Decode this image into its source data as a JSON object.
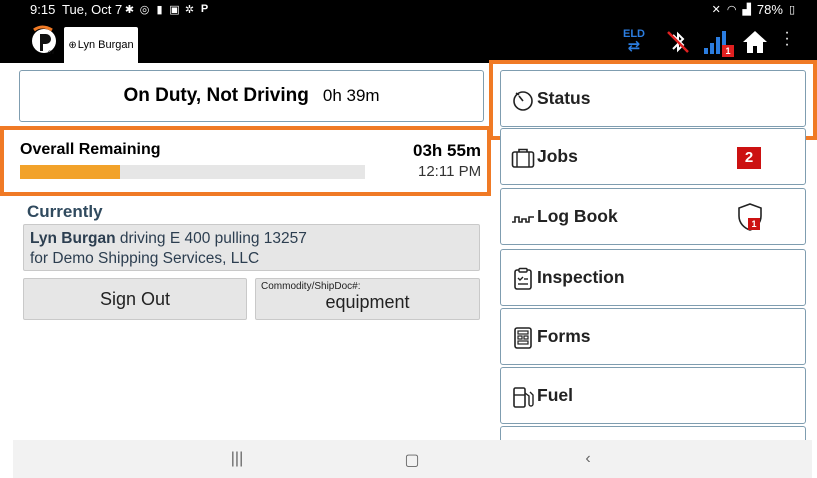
{
  "status_bar": {
    "time": "9:15",
    "date": "Tue, Oct 7",
    "left_icons": [
      "bluetooth-icon",
      "sync-icon",
      "battery-saver-icon",
      "gallery-icon",
      "settings-icon",
      "p-app-icon"
    ],
    "battery": "78%",
    "right_icons": [
      "mute-icon",
      "wifi-icon",
      "cellular-icon",
      "battery-icon"
    ]
  },
  "app_bar": {
    "user_tab": "Lyn Burgan",
    "eld_label": "ELD",
    "signal_badge": "1"
  },
  "duty": {
    "status": "On Duty, Not Driving",
    "elapsed": "0h 39m"
  },
  "remaining": {
    "title": "Overall Remaining",
    "time": "03h 55m",
    "clock": "12:11 PM",
    "progress_fraction": 0.29
  },
  "currently": {
    "heading": "Currently",
    "driver_name": "Lyn Burgan",
    "driving_text": " driving E 400 pulling 13257",
    "company_text": "for Demo Shipping Services, LLC"
  },
  "actions": {
    "sign_out": "Sign Out",
    "commodity_label": "Commodity/ShipDoc#:",
    "commodity_value": "equipment"
  },
  "menu": {
    "items": [
      {
        "label": "Status",
        "icon": "timer-icon"
      },
      {
        "label": "Jobs",
        "icon": "briefcase-icon",
        "badge": "2"
      },
      {
        "label": "Log Book",
        "icon": "logbook-wave-icon",
        "badge": "1"
      },
      {
        "label": "Inspection",
        "icon": "clipboard-check-icon"
      },
      {
        "label": "Forms",
        "icon": "form-icon"
      },
      {
        "label": "Fuel",
        "icon": "fuel-pump-icon"
      }
    ]
  },
  "colors": {
    "highlight": "#f07a25",
    "progress": "#f2a22a",
    "badge": "#cc1111",
    "eld": "#2b7de0"
  }
}
